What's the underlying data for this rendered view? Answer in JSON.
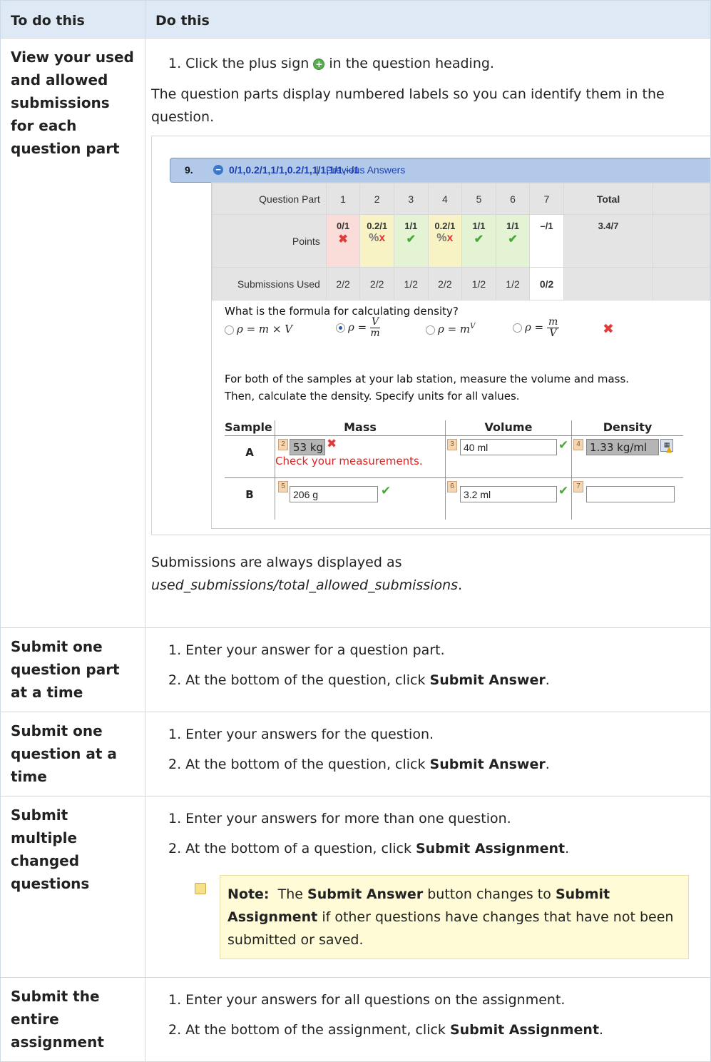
{
  "header": {
    "col1": "To do this",
    "col2": "Do this"
  },
  "rows": [
    {
      "task": "View your used and allowed submissions for each question part",
      "steps": [
        "1. Click the plus sign",
        "in the question heading."
      ],
      "desc": "The question parts display numbered labels so you can identify them in the question.",
      "footer_a": "Submissions are always displayed as",
      "footer_b": "used_submissions/total_allowed_submissions",
      "footer_c": "."
    },
    {
      "task": "Submit one question part at a time",
      "steps": [
        "1. Enter your answer for a question part.",
        "2. At the bottom of the question, click",
        "Submit Answer",
        "."
      ]
    },
    {
      "task": "Submit one question at a time",
      "steps": [
        "1. Enter your answers for the question.",
        "2. At the bottom of the question, click",
        "Submit Answer",
        "."
      ]
    },
    {
      "task": "Submit multiple changed questions",
      "steps": [
        "1. Enter your answers for more than one question.",
        "2. At the bottom of a question, click",
        "Submit Assignment",
        "."
      ],
      "note": {
        "label": "Note:",
        "t1": "The",
        "b1": "Submit Answer",
        "t2": "button changes to",
        "b2": "Submit Assignment",
        "t3": "if other questions have changes that have not been submitted or saved."
      }
    },
    {
      "task": "Submit the entire assignment",
      "steps": [
        "1. Enter your answers for all questions on the assignment.",
        "2. At the bottom of the assignment, click",
        "Submit Assignment",
        "."
      ]
    }
  ],
  "screenshot": {
    "qnum": "9.",
    "points": [
      "0/1",
      "0.2/1",
      "1/1",
      "0.2/1",
      "1/1",
      "1/1",
      "–/1"
    ],
    "sep": "|",
    "prev": "Previous Answers",
    "part_label": "Question Part",
    "parts": [
      "1",
      "2",
      "3",
      "4",
      "5",
      "6",
      "7"
    ],
    "total_label": "Total",
    "points_label": "Points",
    "point_marks": [
      "x",
      "partial",
      "check",
      "partial",
      "check",
      "check",
      ""
    ],
    "total_points": "3.4/7",
    "subs_label": "Submissions Used",
    "subs": [
      "2/2",
      "2/2",
      "1/2",
      "2/2",
      "1/2",
      "1/2",
      "0/2"
    ],
    "question": "What is the formula for calculating density?",
    "opt1": "ρ = m × V",
    "opt2_pre": "ρ =",
    "opt2_num": "V",
    "opt2_den": "m",
    "opt3": "ρ = m",
    "opt3_sup": "V",
    "opt4_pre": "ρ =",
    "opt4_num": "m",
    "opt4_den": "V",
    "para1": "For both of the samples at your lab station, measure the volume and mass.",
    "para2": "Then, calculate the density. Specify units for all values.",
    "cols": [
      "Sample",
      "Mass",
      "Volume",
      "Density"
    ],
    "sampleA": "A",
    "sampleB": "B",
    "massA": "53 kg",
    "massA_error": "Check your measurements.",
    "volA": "40 ml",
    "densA": "1.33 kg/ml",
    "massB": "206 g",
    "volB": "3.2 ml",
    "densB": "",
    "tags": [
      "2",
      "3",
      "4",
      "5",
      "6",
      "7"
    ],
    "colors": {
      "header_bg": "#b3c9ea",
      "link": "#1a3fb1",
      "error": "#e23b3b",
      "correct": "#4aa83a"
    }
  }
}
